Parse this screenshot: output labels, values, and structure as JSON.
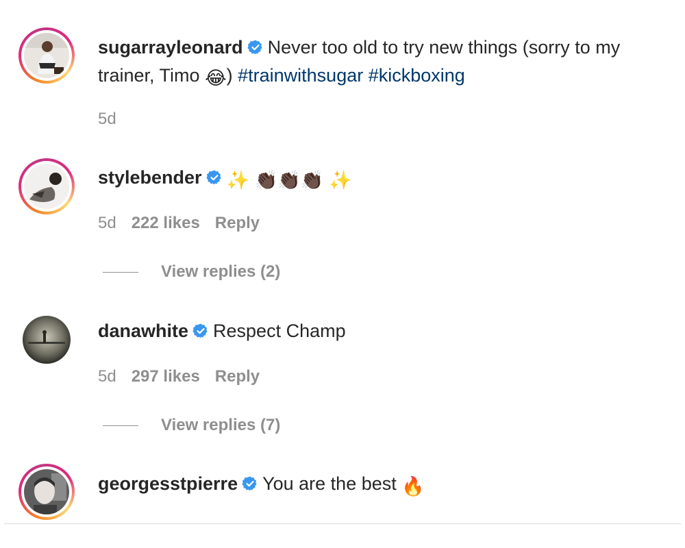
{
  "caption": {
    "username": "sugarrayleonard",
    "text_before": "Never too old to try new things (sorry to my trainer, Timo ",
    "emoji": "😂",
    "text_after": ") ",
    "hashtag1": "#trainwithsugar",
    "hashtag2": "#kickboxing",
    "time": "5d"
  },
  "comments": [
    {
      "username": "stylebender",
      "text": "✨ 👏🏿👏🏿👏🏿 ✨",
      "time": "5d",
      "likes": "222 likes",
      "reply_label": "Reply",
      "view_replies": "View replies (2)"
    },
    {
      "username": "danawhite",
      "text": "Respect Champ",
      "time": "5d",
      "likes": "297 likes",
      "reply_label": "Reply",
      "view_replies": "View replies (7)"
    },
    {
      "username": "georgesstpierre",
      "text": "You are the best",
      "emoji": "🔥"
    }
  ],
  "colors": {
    "text": "#262626",
    "muted": "#8e8e8e",
    "hashtag": "#00376b",
    "verified": "#3897f0"
  }
}
